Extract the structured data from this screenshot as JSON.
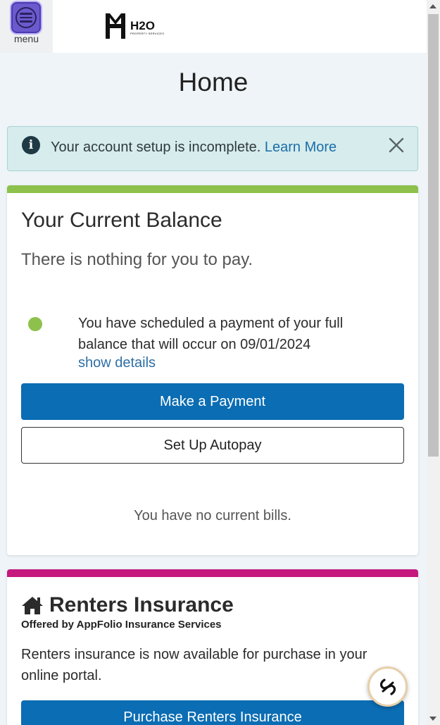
{
  "header": {
    "menu_label": "menu",
    "logo_text": "H2O",
    "logo_subtext": "PROPERTY SERVICES"
  },
  "page": {
    "title": "Home"
  },
  "alert": {
    "icon": "info-icon",
    "message": "Your account setup is incomplete.",
    "link_label": "Learn More",
    "close_icon": "close-icon"
  },
  "balance": {
    "stripe_color": "#8dc14b",
    "title": "Your Current Balance",
    "status": "There is nothing for you to pay.",
    "scheduled_text": "You have scheduled a payment of your full balance that will occur on 09/01/2024",
    "show_details_label": "show details",
    "make_payment_label": "Make a Payment",
    "autopay_label": "Set Up Autopay",
    "no_bills_text": "You have no current bills."
  },
  "insurance": {
    "stripe_color": "#c5197d",
    "icon": "house-icon",
    "title": "Renters Insurance",
    "subtitle": "Offered by AppFolio Insurance Services",
    "body": "Renters insurance is now available for purchase in your online portal.",
    "purchase_label": "Purchase Renters Insurance"
  },
  "chat": {
    "icon": "chat-bot-icon"
  },
  "colors": {
    "primary": "#0b6db3",
    "page_bg": "#eef4f7",
    "alert_bg": "#d7ecec",
    "link": "#2f6fa5"
  }
}
